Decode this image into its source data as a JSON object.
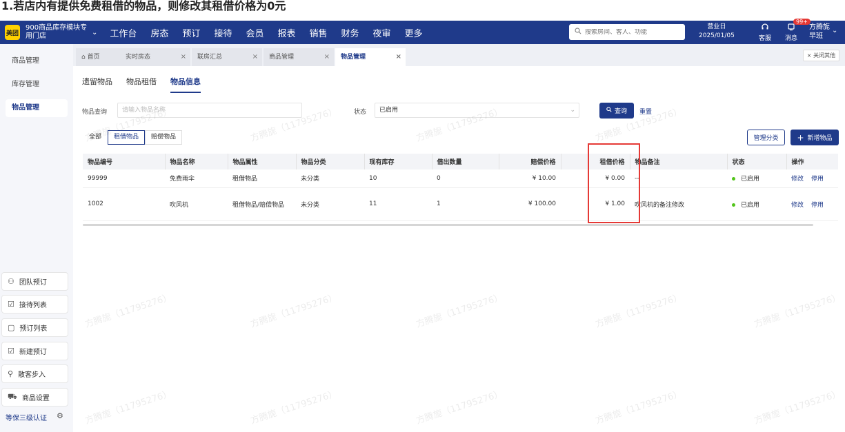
{
  "caption": "1.若店内有提供免费租借的物品，则修改其租借价格为0元",
  "topbar": {
    "logo": "美团",
    "store_name": "900商品库存模块专用门店",
    "nav": [
      "工作台",
      "房态",
      "预订",
      "接待",
      "会员",
      "报表",
      "销售",
      "财务",
      "夜审",
      "更多"
    ],
    "search_placeholder": "搜索房间、客人、功能",
    "biz_label": "营业日",
    "biz_date": "2025/01/05",
    "service_label": "客服",
    "message_label": "消息",
    "message_badge": "99+",
    "user_name": "方腾旎",
    "shift": "早班"
  },
  "sidebar": {
    "items": [
      "商品管理",
      "库存管理",
      "物品管理"
    ],
    "quick": [
      "团队预订",
      "接待列表",
      "预订列表",
      "新建预订",
      "散客步入",
      "商品设置"
    ],
    "cert": "等保三级认证"
  },
  "tabs": {
    "items": [
      "首页",
      "实时房态",
      "联房汇总",
      "商品管理",
      "物品管理"
    ],
    "close_others": "× 关闭其他"
  },
  "subtabs": [
    "遗留物品",
    "物品租借",
    "物品信息"
  ],
  "filters": {
    "query_label": "物品查询",
    "query_placeholder": "请输入物品名称",
    "status_label": "状态",
    "status_value": "已启用",
    "search_button": "查询",
    "reset_button": "重置"
  },
  "segments": [
    "全部",
    "租借物品",
    "赔偿物品"
  ],
  "actions": {
    "manage_category": "管理分类",
    "add_item": "新增物品"
  },
  "table": {
    "headers": [
      "物品编号",
      "物品名称",
      "物品属性",
      "物品分类",
      "现有库存",
      "借出数量",
      "赔偿价格",
      "租借价格",
      "物品备注",
      "状态",
      "操作"
    ],
    "rows": [
      {
        "id": "99999",
        "name": "免费雨伞",
        "attr": "租借物品",
        "category": "未分类",
        "stock": "10",
        "lent": "0",
        "comp_price": "¥ 10.00",
        "rent_price": "¥ 0.00",
        "note": "--",
        "status": "已启用",
        "op1": "修改",
        "op2": "停用"
      },
      {
        "id": "1002",
        "name": "吹风机",
        "attr": "租借物品/赔偿物品",
        "category": "未分类",
        "stock": "11",
        "lent": "1",
        "comp_price": "¥ 100.00",
        "rent_price": "¥ 1.00",
        "note": "吹风机的备注修改",
        "status": "已启用",
        "op1": "修改",
        "op2": "停用"
      }
    ]
  },
  "watermark": "方腾旎（11795276）",
  "colors": {
    "primary": "#1f3a8a",
    "highlight": "#e53935",
    "status_ok": "#52c41a"
  }
}
